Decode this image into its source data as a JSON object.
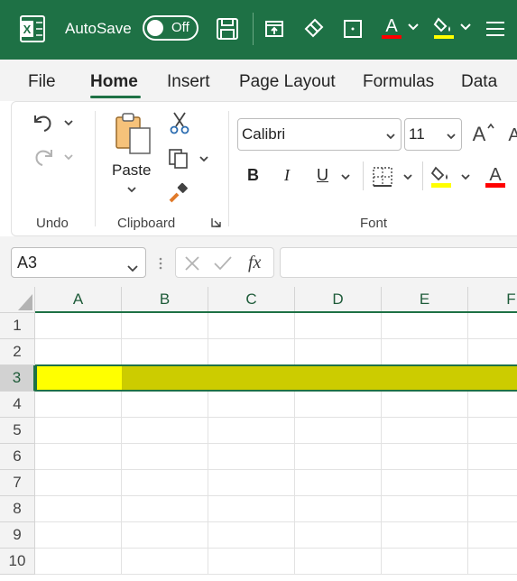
{
  "titlebar": {
    "autosave_label": "AutoSave",
    "toggle_state": "Off",
    "colors": {
      "background": "#1e7145",
      "font_color_bar": "#ff0000",
      "fill_color_bar": "#ffff00"
    }
  },
  "tabs": [
    "File",
    "Home",
    "Insert",
    "Page Layout",
    "Formulas",
    "Data"
  ],
  "active_tab": "Home",
  "ribbon": {
    "undo_group": {
      "label": "Undo"
    },
    "clipboard_group": {
      "label": "Clipboard",
      "paste_label": "Paste"
    },
    "font_group": {
      "label": "Font",
      "font_name": "Calibri",
      "font_size": "11",
      "bold": "B",
      "italic": "I",
      "underline": "U"
    }
  },
  "formula_bar": {
    "name_box": "A3",
    "fx_label": "fx",
    "formula": ""
  },
  "grid": {
    "columns": [
      "A",
      "B",
      "C",
      "D",
      "E",
      "F"
    ],
    "rows": [
      "1",
      "2",
      "3",
      "4",
      "5",
      "6",
      "7",
      "8",
      "9",
      "10"
    ],
    "selected_row": "3",
    "active_cell": "A3",
    "colors": {
      "active_cell_fill": "#ffff00",
      "row_fill": "#cccc00",
      "selection_border": "#1e7145"
    }
  }
}
